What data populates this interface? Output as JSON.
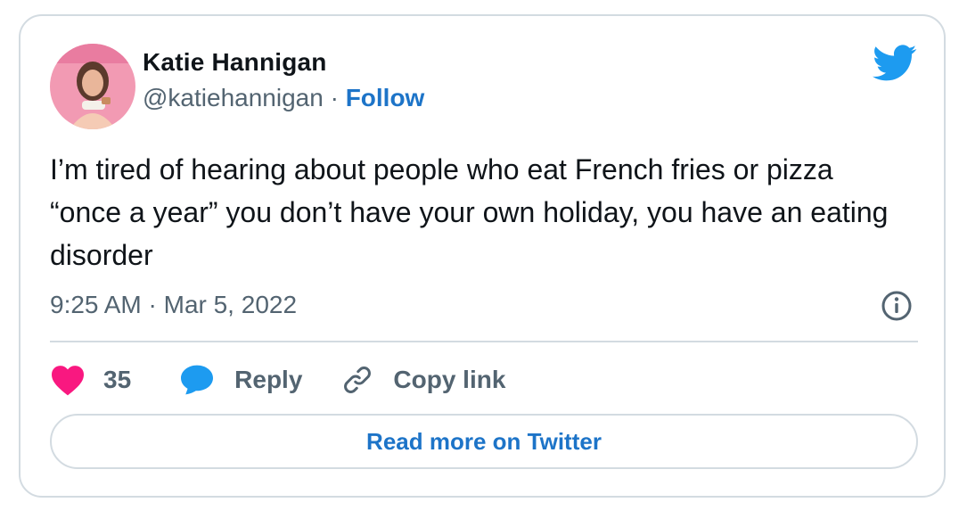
{
  "tweet": {
    "author": {
      "name": "Katie Hannigan",
      "handle": "@katiehannigan",
      "separator": "·",
      "follow_label": "Follow",
      "avatar_icon": "profile-photo"
    },
    "platform_icon": "twitter-bird-icon",
    "text": "I’m tired of hearing about people who eat French fries or pizza “once a year” you don’t have your own holiday, you have an eating disorder",
    "timestamp": "9:25 AM · Mar 5, 2022",
    "info_icon": "info-icon",
    "actions": {
      "like_count": "35",
      "reply_label": "Reply",
      "copy_label": "Copy link"
    },
    "read_more_label": "Read more on Twitter"
  },
  "colors": {
    "twitter_blue": "#1d9bf0",
    "link_blue": "#1d74c8",
    "heart_red": "#f91880",
    "text_primary": "#0f1419",
    "text_secondary": "#536471",
    "border": "#d3dbe1"
  }
}
